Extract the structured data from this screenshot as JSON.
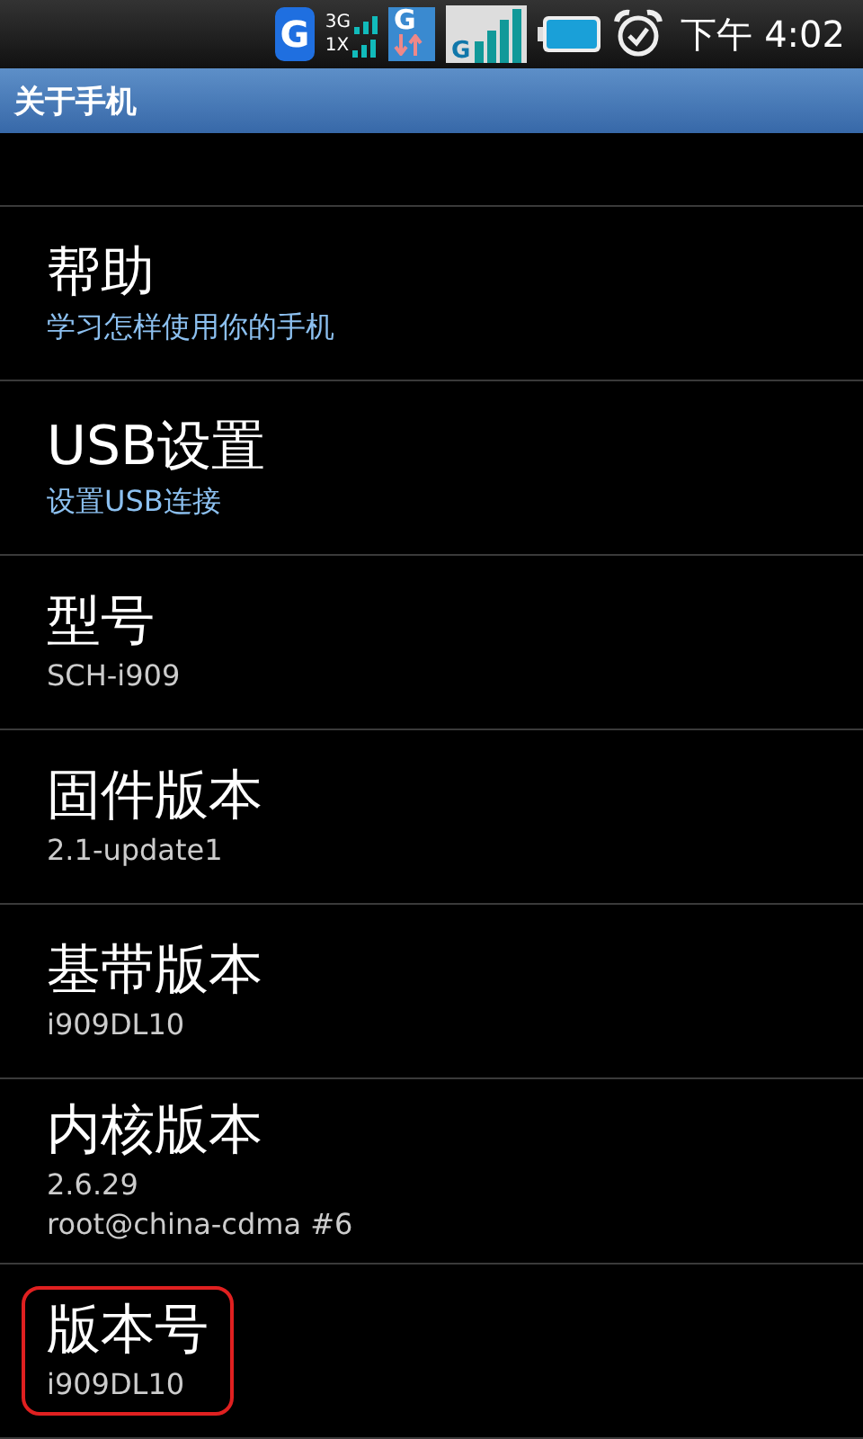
{
  "status_bar": {
    "icons": [
      {
        "kind": "g-badge",
        "label": "G"
      },
      {
        "kind": "network",
        "labels": [
          "3G",
          "1X"
        ]
      },
      {
        "kind": "g-data",
        "label": "G"
      },
      {
        "kind": "g-signal",
        "label": "G"
      },
      {
        "kind": "battery"
      },
      {
        "kind": "alarm"
      }
    ],
    "time": "下午 4:02"
  },
  "title": "关于手机",
  "items": [
    {
      "title": "帮助",
      "summary": [
        "学习怎样使用你的手机"
      ],
      "summary_accent": true,
      "highlighted": false
    },
    {
      "title": "USB设置",
      "summary": [
        "设置USB连接"
      ],
      "summary_accent": true,
      "highlighted": false
    },
    {
      "title": "型号",
      "summary": [
        "SCH-i909"
      ],
      "summary_accent": false,
      "highlighted": false
    },
    {
      "title": "固件版本",
      "summary": [
        "2.1-update1"
      ],
      "summary_accent": false,
      "highlighted": false
    },
    {
      "title": "基带版本",
      "summary": [
        "i909DL10"
      ],
      "summary_accent": false,
      "highlighted": false
    },
    {
      "title": "内核版本",
      "summary": [
        "2.6.29",
        "root@china-cdma #6"
      ],
      "summary_accent": false,
      "highlighted": false
    },
    {
      "title": "版本号",
      "summary": [
        "i909DL10"
      ],
      "summary_accent": false,
      "highlighted": true
    }
  ]
}
